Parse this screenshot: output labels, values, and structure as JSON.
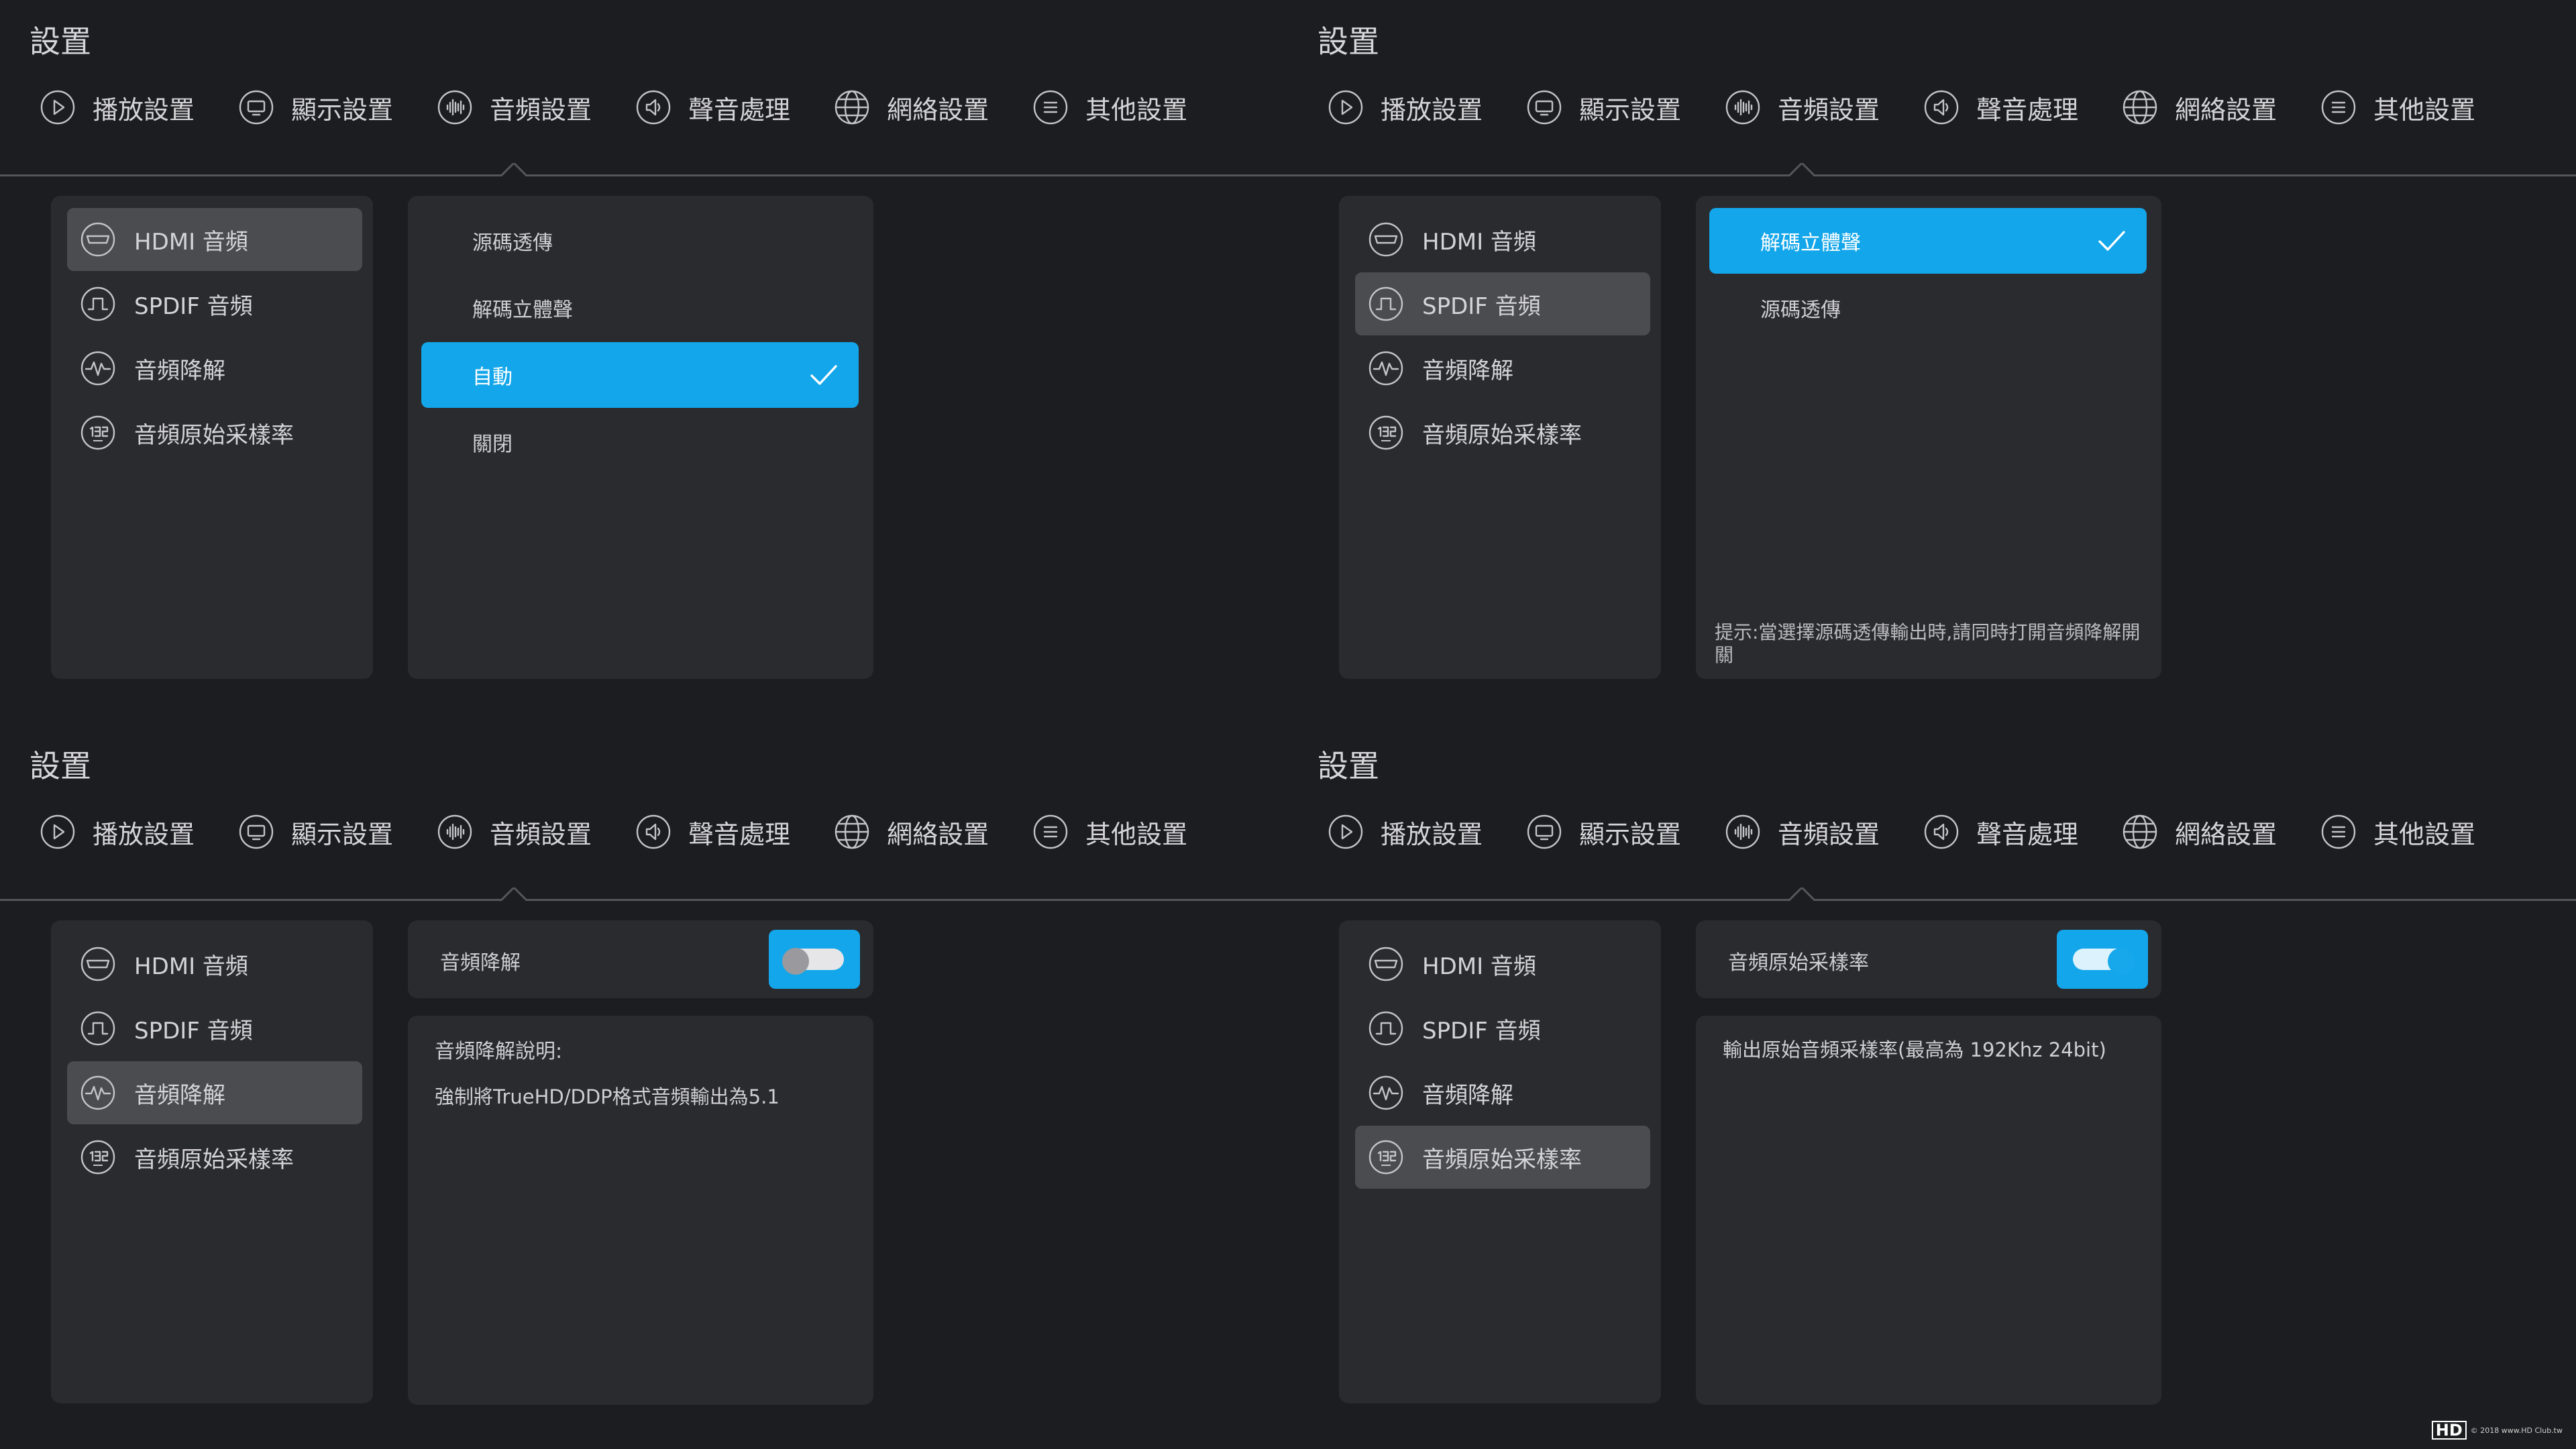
{
  "quadrants": [
    {
      "title": "設置",
      "tabs": [
        {
          "label": "播放設置",
          "icon": "play-icon"
        },
        {
          "label": "顯示設置",
          "icon": "monitor-icon"
        },
        {
          "label": "音頻設置",
          "icon": "audio-wave-icon"
        },
        {
          "label": "聲音處理",
          "icon": "speaker-icon"
        },
        {
          "label": "網絡設置",
          "icon": "globe-icon"
        },
        {
          "label": "其他設置",
          "icon": "menu-icon"
        }
      ],
      "active_tab": 2,
      "sidebar": [
        {
          "label": "HDMI 音頻",
          "icon": "hdmi-icon"
        },
        {
          "label": "SPDIF 音頻",
          "icon": "spdif-icon"
        },
        {
          "label": "音頻降解",
          "icon": "waveform-icon"
        },
        {
          "label": "音頻原始采樣率",
          "icon": "samplerate-192-icon"
        }
      ],
      "selected_sidebar": 0,
      "options": [
        "源碼透傳",
        "解碼立體聲",
        "自動",
        "關閉"
      ],
      "selected_option": 2
    },
    {
      "title": "設置",
      "tabs": [
        {
          "label": "播放設置",
          "icon": "play-icon"
        },
        {
          "label": "顯示設置",
          "icon": "monitor-icon"
        },
        {
          "label": "音頻設置",
          "icon": "audio-wave-icon"
        },
        {
          "label": "聲音處理",
          "icon": "speaker-icon"
        },
        {
          "label": "網絡設置",
          "icon": "globe-icon"
        },
        {
          "label": "其他設置",
          "icon": "menu-icon"
        }
      ],
      "active_tab": 2,
      "sidebar": [
        {
          "label": "HDMI 音頻",
          "icon": "hdmi-icon"
        },
        {
          "label": "SPDIF 音頻",
          "icon": "spdif-icon"
        },
        {
          "label": "音頻降解",
          "icon": "waveform-icon"
        },
        {
          "label": "音頻原始采樣率",
          "icon": "samplerate-192-icon"
        }
      ],
      "selected_sidebar": 1,
      "options": [
        "解碼立體聲",
        "源碼透傳"
      ],
      "selected_option": 0,
      "hint": "提示:當選擇源碼透傳輸出時,請同時打開音頻降解開關"
    },
    {
      "title": "設置",
      "tabs": [
        {
          "label": "播放設置",
          "icon": "play-icon"
        },
        {
          "label": "顯示設置",
          "icon": "monitor-icon"
        },
        {
          "label": "音頻設置",
          "icon": "audio-wave-icon"
        },
        {
          "label": "聲音處理",
          "icon": "speaker-icon"
        },
        {
          "label": "網絡設置",
          "icon": "globe-icon"
        },
        {
          "label": "其他設置",
          "icon": "menu-icon"
        }
      ],
      "active_tab": 2,
      "sidebar": [
        {
          "label": "HDMI 音頻",
          "icon": "hdmi-icon"
        },
        {
          "label": "SPDIF 音頻",
          "icon": "spdif-icon"
        },
        {
          "label": "音頻降解",
          "icon": "waveform-icon"
        },
        {
          "label": "音頻原始采樣率",
          "icon": "samplerate-192-icon"
        }
      ],
      "selected_sidebar": 2,
      "toggle": {
        "label": "音頻降解",
        "on": false
      },
      "description": {
        "title": "音頻降解說明:",
        "text": "強制將TrueHD/DDP格式音頻輸出為5.1"
      }
    },
    {
      "title": "設置",
      "tabs": [
        {
          "label": "播放設置",
          "icon": "play-icon"
        },
        {
          "label": "顯示設置",
          "icon": "monitor-icon"
        },
        {
          "label": "音頻設置",
          "icon": "audio-wave-icon"
        },
        {
          "label": "聲音處理",
          "icon": "speaker-icon"
        },
        {
          "label": "網絡設置",
          "icon": "globe-icon"
        },
        {
          "label": "其他設置",
          "icon": "menu-icon"
        }
      ],
      "active_tab": 2,
      "sidebar": [
        {
          "label": "HDMI 音頻",
          "icon": "hdmi-icon"
        },
        {
          "label": "SPDIF 音頻",
          "icon": "spdif-icon"
        },
        {
          "label": "音頻降解",
          "icon": "waveform-icon"
        },
        {
          "label": "音頻原始采樣率",
          "icon": "samplerate-192-icon"
        }
      ],
      "selected_sidebar": 3,
      "toggle": {
        "label": "音頻原始采樣率",
        "on": true
      },
      "description": {
        "text": "輸出原始音頻采樣率(最高為 192Khz 24bit)"
      }
    }
  ],
  "watermark": {
    "logo": "HD",
    "text": "© 2018 www.HD Club.tw"
  },
  "colors": {
    "background": "#1c1d20",
    "panel": "#2a2b2e",
    "selected": "#4b4c50",
    "accent": "#13a6ea"
  }
}
